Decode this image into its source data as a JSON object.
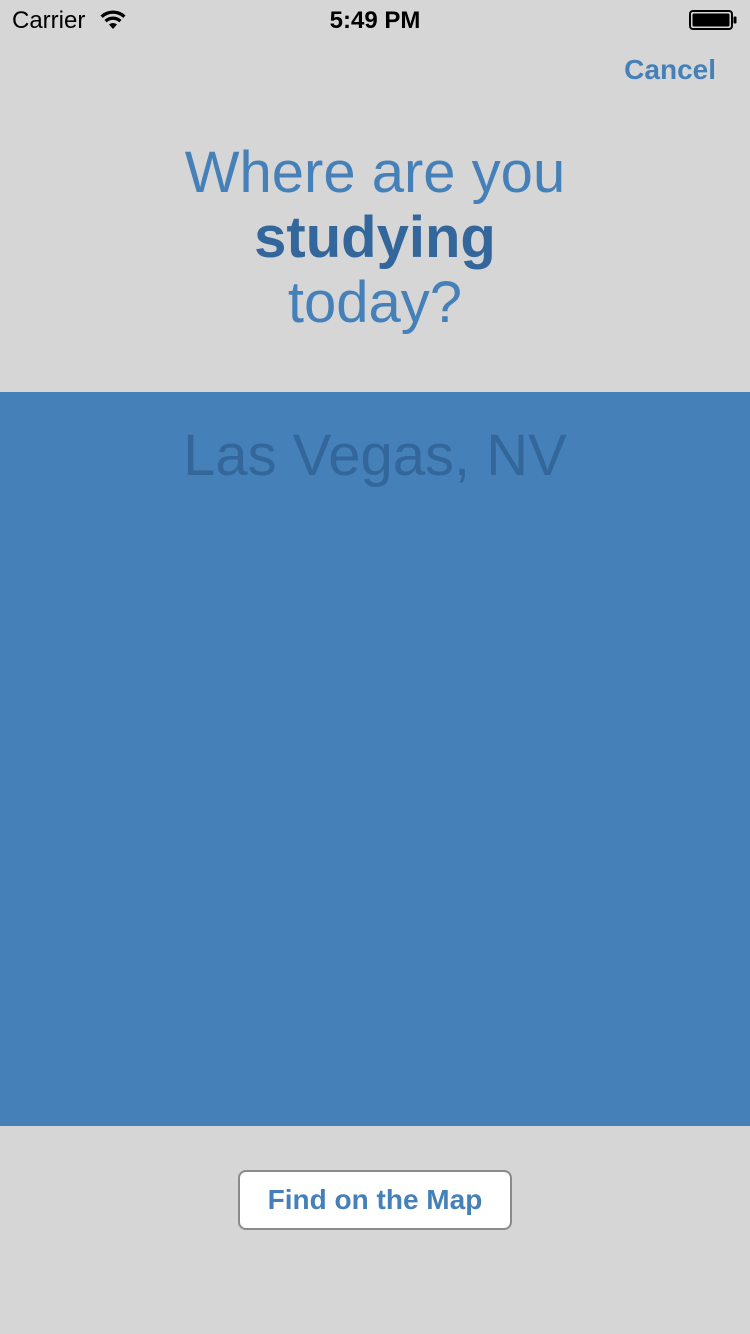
{
  "status_bar": {
    "carrier": "Carrier",
    "time": "5:49 PM",
    "wifi_icon": "wifi-icon",
    "battery_icon": "battery-icon"
  },
  "nav": {
    "cancel_label": "Cancel"
  },
  "prompt": {
    "line1": "Where are you",
    "line2": "studying",
    "line3": "today?"
  },
  "location": {
    "placeholder": "Las Vegas, NV"
  },
  "actions": {
    "find_on_map_label": "Find on the Map"
  },
  "colors": {
    "background": "#d6d6d6",
    "accent": "#4581b8",
    "accent_dark": "#33679c",
    "button_bg": "#ffffff"
  }
}
